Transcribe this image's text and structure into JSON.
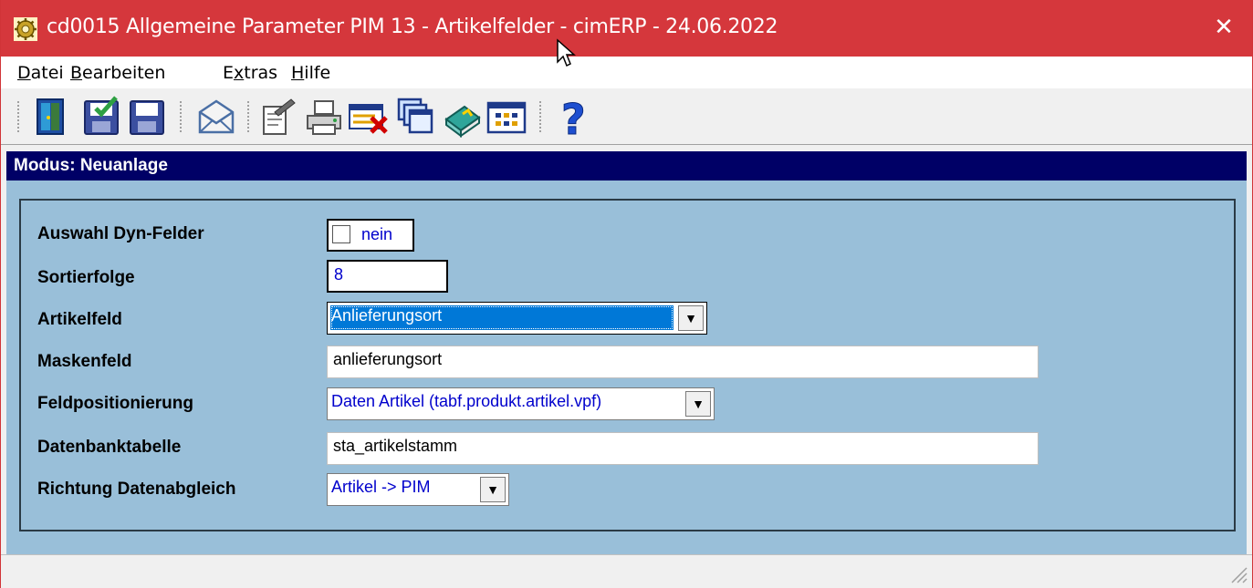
{
  "window": {
    "title": "cd0015 Allgemeine Parameter PIM 13 - Artikelfelder - cimERP - 24.06.2022",
    "close_glyph": "✕",
    "title_bar_color": "#d5373c"
  },
  "menu": {
    "datei": {
      "key": "D",
      "rest": "atei"
    },
    "bearbeiten": {
      "key": "B",
      "rest": "earbeiten"
    },
    "extras": {
      "pre": "E",
      "key": "x",
      "rest": "tras"
    },
    "hilfe": {
      "key": "H",
      "rest": "ilfe"
    }
  },
  "toolbar": {
    "buttons": [
      "exit-icon",
      "save-check-icon",
      "save-icon",
      "mail-icon",
      "edit-document-icon",
      "print-icon",
      "delete-icon",
      "copy-windows-icon",
      "book-icon",
      "grid-icon",
      "help-icon"
    ]
  },
  "mode": {
    "label": "Modus: Neuanlage",
    "background": "#000066"
  },
  "form": {
    "auswahl_dyn": {
      "label": "Auswahl Dyn-Felder",
      "checked": false,
      "text": "nein"
    },
    "sortierfolge": {
      "label": "Sortierfolge",
      "value": "8"
    },
    "artikelfeld": {
      "label": "Artikelfeld",
      "value": "Anlieferungsort"
    },
    "maskenfeld": {
      "label": "Maskenfeld",
      "value": "anlieferungsort"
    },
    "feldpositionierung": {
      "label": "Feldpositionierung",
      "value": "Daten Artikel (tabf.produkt.artikel.vpf)"
    },
    "datenbanktabelle": {
      "label": "Datenbanktabelle",
      "value": "sta_artikelstamm"
    },
    "richtung": {
      "label": "Richtung Datenabgleich",
      "value": "Artikel -> PIM"
    }
  },
  "colors": {
    "content_bg": "#99bfd9",
    "value_blue": "#0000cc",
    "selection": "#0078d7"
  }
}
